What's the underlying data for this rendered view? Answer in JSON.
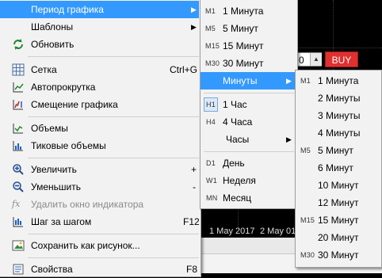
{
  "main_menu": {
    "items": [
      {
        "label": "Период графика",
        "has_submenu": true,
        "highlighted": true,
        "icon": "none"
      },
      {
        "label": "Шаблоны",
        "has_submenu": true,
        "icon": "none"
      },
      {
        "label": "Обновить",
        "icon": "refresh-icon"
      },
      {
        "label": "Сетка",
        "shortcut": "Ctrl+G",
        "icon": "grid-icon"
      },
      {
        "label": "Автопрокрутка",
        "icon": "autoscroll-icon"
      },
      {
        "label": "Смещение графика",
        "icon": "chart-shift-icon"
      },
      {
        "label": "Объемы",
        "icon": "volumes-icon"
      },
      {
        "label": "Тиковые объемы",
        "icon": "tick-volumes-icon"
      },
      {
        "label": "Увеличить",
        "shortcut": "+",
        "icon": "zoom-in-icon"
      },
      {
        "label": "Уменьшить",
        "shortcut": "-",
        "icon": "zoom-out-icon"
      },
      {
        "label": "Удалить окно индикатора",
        "disabled": true,
        "icon": "fx-icon"
      },
      {
        "label": "Шаг за шагом",
        "shortcut": "F12",
        "icon": "step-icon"
      },
      {
        "label": "Сохранить как рисунок...",
        "icon": "save-picture-icon"
      },
      {
        "label": "Свойства",
        "shortcut": "F8",
        "icon": "properties-icon"
      }
    ]
  },
  "period_menu": {
    "items": [
      {
        "prefix": "M1",
        "label": "1 Минута"
      },
      {
        "prefix": "M5",
        "label": "5 Минут"
      },
      {
        "prefix": "M15",
        "label": "15 Минут"
      },
      {
        "prefix": "M30",
        "label": "30 Минут"
      },
      {
        "prefix": "",
        "label": "Минуты",
        "has_submenu": true,
        "highlighted": true
      },
      {
        "prefix": "H1",
        "label": "1 Час",
        "checked": true
      },
      {
        "prefix": "H4",
        "label": "4 Часа"
      },
      {
        "prefix": "",
        "label": "Часы",
        "has_submenu": true
      },
      {
        "prefix": "D1",
        "label": "День"
      },
      {
        "prefix": "W1",
        "label": "Неделя"
      },
      {
        "prefix": "MN",
        "label": "Месяц"
      }
    ]
  },
  "minutes_menu": {
    "items": [
      {
        "prefix": "M1",
        "label": "1 Минута"
      },
      {
        "prefix": "",
        "label": "2 Минуты"
      },
      {
        "prefix": "",
        "label": "3 Минуты"
      },
      {
        "prefix": "",
        "label": "4 Минуты"
      },
      {
        "prefix": "M5",
        "label": "5 Минут"
      },
      {
        "prefix": "",
        "label": "6 Минут"
      },
      {
        "prefix": "",
        "label": "10 Минут"
      },
      {
        "prefix": "",
        "label": "12 Минут"
      },
      {
        "prefix": "M15",
        "label": "15 Минут"
      },
      {
        "prefix": "",
        "label": "20 Минут"
      },
      {
        "prefix": "M30",
        "label": "30 Минут"
      }
    ]
  },
  "chart": {
    "date_labels": [
      "1 May 2017",
      "2 May 01:"
    ],
    "trade_panel": {
      "volume_value": "0",
      "buy_label": "BUY"
    },
    "colors": {
      "background": "#000000",
      "candle": "#00c000",
      "buy": "#e03030",
      "highlight": "#3399ff"
    }
  }
}
